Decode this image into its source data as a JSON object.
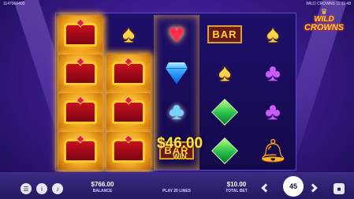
{
  "header": {
    "game_id": "1147066400",
    "title_time": "WILD CROWNS 11:11:48"
  },
  "logo": {
    "line1": "WILD",
    "line2": "CROWNS"
  },
  "reels": [
    [
      "crown",
      "crown",
      "crown",
      "crown"
    ],
    [
      "spade",
      "crown",
      "crown",
      "crown"
    ],
    [
      "heart",
      "diamond",
      "club-blue",
      "bar"
    ],
    [
      "bar",
      "spade",
      "green-diamond",
      "green-diamond"
    ],
    [
      "spade",
      "club-purple",
      "club-purple",
      "bell"
    ]
  ],
  "symbols": {
    "bar_text": "BAR"
  },
  "win": {
    "label": "WIN",
    "amount": "$46.00"
  },
  "footer": {
    "balance_value": "$766.00",
    "balance_label": "BALANCE",
    "lines_label": "PLAY 20 LINES",
    "bet_value": "$10.00",
    "bet_label": "TOTAL BET",
    "autoplay_count": "45"
  },
  "icons": {
    "menu": "menu-icon",
    "info": "info-icon",
    "sound": "sound-icon",
    "bet_minus": "chevron-left-icon",
    "bet_plus": "chevron-right-icon",
    "stop": "stop-icon"
  },
  "colors": {
    "background": "#3b1c8e",
    "accent_gold": "#ffd23a"
  }
}
